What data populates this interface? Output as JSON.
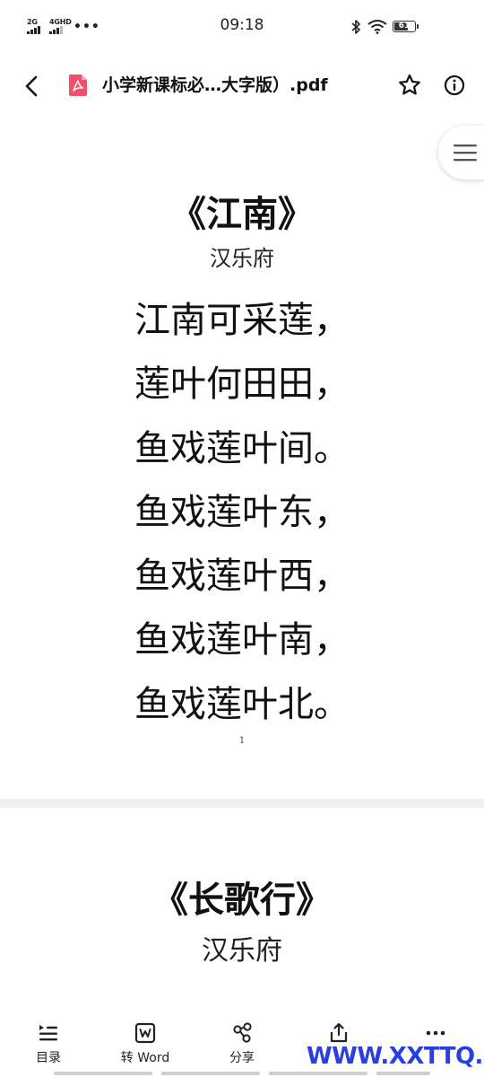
{
  "status_bar": {
    "signal1_label": "2G",
    "signal2_label": "4GHD",
    "more_dots": "•••",
    "time": "09:18",
    "battery_level": "61",
    "battery_fraction": 0.61
  },
  "app_bar": {
    "file_title": "小学新课标必…大字版）.pdf"
  },
  "document": {
    "page1": {
      "title": "《江南》",
      "author": "汉乐府",
      "lines": [
        "江南可采莲，",
        "莲叶何田田，",
        "鱼戏莲叶间。",
        "鱼戏莲叶东，",
        "鱼戏莲叶西，",
        "鱼戏莲叶南，",
        "鱼戏莲叶北。"
      ],
      "page_number": "1"
    },
    "page2": {
      "title": "《长歌行》",
      "author": "汉乐府"
    }
  },
  "toolbar": {
    "items": [
      {
        "label": "目录",
        "icon": "list-icon"
      },
      {
        "label": "转 Word",
        "icon": "convert-word-icon"
      },
      {
        "label": "分享",
        "icon": "share-nodes-icon"
      },
      {
        "label": "",
        "icon": "export-icon"
      },
      {
        "label": "",
        "icon": "more-icon"
      }
    ]
  },
  "watermark": "WWW.XXTTQ.COM",
  "colors": {
    "pdf_icon": "#f0506e",
    "watermark": "#2a3fe0",
    "page_gap": "#efefef"
  }
}
